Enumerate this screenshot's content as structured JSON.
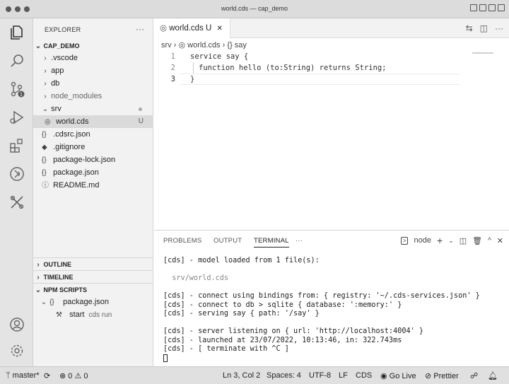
{
  "window": {
    "title": "world.cds — cap_demo"
  },
  "explorer": {
    "title": "EXPLORER",
    "more": "···",
    "root": "CAP_DEMO",
    "items": [
      {
        "label": ".vscode",
        "type": "folder"
      },
      {
        "label": "app",
        "type": "folder"
      },
      {
        "label": "db",
        "type": "folder"
      },
      {
        "label": "node_modules",
        "type": "folder"
      },
      {
        "label": "srv",
        "type": "folder-open"
      },
      {
        "label": "world.cds",
        "type": "file",
        "badge": "U"
      },
      {
        "label": ".cdsrc.json",
        "type": "json"
      },
      {
        "label": ".gitignore",
        "type": "file"
      },
      {
        "label": "package-lock.json",
        "type": "json"
      },
      {
        "label": "package.json",
        "type": "json"
      },
      {
        "label": "README.md",
        "type": "info"
      }
    ],
    "json_icon": "{}",
    "info_icon": "ⓘ",
    "sections": {
      "outline": "OUTLINE",
      "timeline": "TIMELINE",
      "npm_scripts": "NPM SCRIPTS"
    },
    "npm": {
      "package": "package.json",
      "script_name": "start",
      "script_cmd": "cds run"
    }
  },
  "editor": {
    "tab_label": "world.cds",
    "tab_badge": "U",
    "tab_close": "✕",
    "breadcrumb": [
      "srv",
      "world.cds",
      "{} say"
    ],
    "lines": [
      {
        "num": "1",
        "text": "service say {"
      },
      {
        "num": "2",
        "text": "function hello (to:String) returns String;"
      },
      {
        "num": "3",
        "text": "}"
      }
    ]
  },
  "panel": {
    "tabs": [
      "PROBLEMS",
      "OUTPUT",
      "TERMINAL",
      "···"
    ],
    "active_tab": "TERMINAL",
    "terminal_name": "node",
    "terminal_lines": [
      "[cds] - model loaded from 1 file(s):",
      "",
      "  srv/world.cds",
      "",
      "[cds] - connect using bindings from: { registry: '~/.cds-services.json' }",
      "[cds] - connect to db > sqlite { database: ':memory:' }",
      "[cds] - serving say { path: '/say' }",
      "",
      "[cds] - server listening on { url: 'http://localhost:4004' }",
      "[cds] - launched at 23/07/2022, 10:13:46, in: 322.743ms",
      "[cds] - [ terminate with ^C ]"
    ]
  },
  "statusbar": {
    "branch": "master*",
    "errors": "0",
    "warnings": "0",
    "position": "Ln 3, Col 2",
    "spaces": "Spaces: 4",
    "encoding": "UTF-8",
    "eol": "LF",
    "language": "CDS",
    "golive": "Go Live",
    "prettier": "Prettier"
  }
}
